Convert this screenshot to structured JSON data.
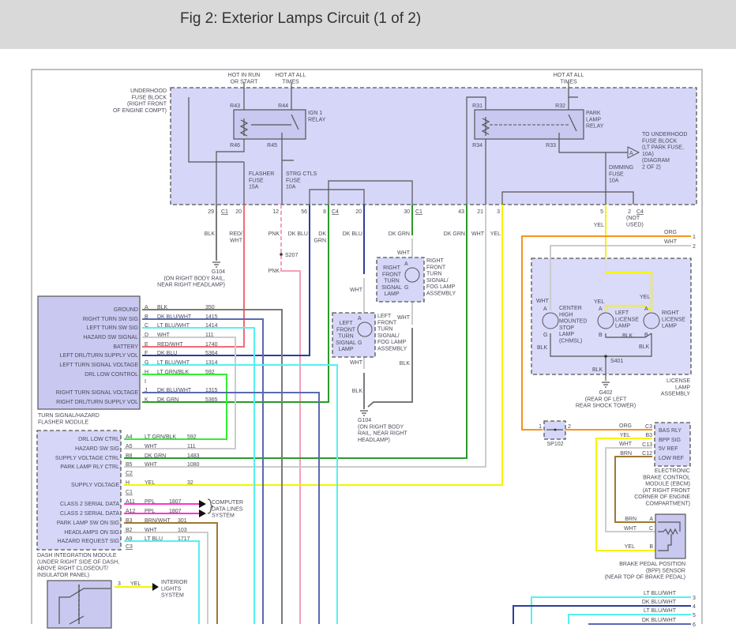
{
  "header": {
    "title": "Fig 2: Exterior Lamps Circuit (1 of 2)"
  },
  "colors": {
    "BLK": "#7a7a7a",
    "RED/WHT": "#f06a78",
    "PNK": "#f5a0b8",
    "DK BLU": "#2c3e9e",
    "DK GRN": "#2a9a2a",
    "LT BLU/WHT": "#55f0f0",
    "WHT": "#cccccc",
    "YEL": "#f4f400",
    "ORG": "#f7931e",
    "LT GRN/BLK": "#33ee33",
    "BRN": "#a07830",
    "PPL": "#ff33cc",
    "DK BLU/WHT": "#5a6ab0",
    "module_fill": "#d6d6f8"
  },
  "power": {
    "hot_run_start": "HOT IN RUN\nOR START",
    "hot_all_times_1": "HOT AT ALL\nTIMES",
    "hot_all_times_2": "HOT AT ALL\nTIMES"
  },
  "fuse_block": {
    "label": "UNDERHOOD\nFUSE BLOCK\n(RIGHT FRONT\nOF ENGINE COMPT)",
    "ign_relay": "IGN 1\nRELAY",
    "park_relay": "PARK\nLAMP\nRELAY",
    "terminals": {
      "r43": "R43",
      "r44": "R44",
      "r45": "R45",
      "r46": "R46",
      "r31": "R31",
      "r32": "R32",
      "r33": "R33",
      "r34": "R34"
    },
    "flasher_fuse": "FLASHER\nFUSE\n15A",
    "strg_fuse": "STRG CTLS\nFUSE\n10A",
    "dimming_fuse": "DIMMING\nFUSE\n10A",
    "offpage_ref": "A",
    "to_underhood": "TO UNDERHOOD\nFUSE BLOCK\n(LT PARK FUSE,\n10A)\n(DIAGRAM\n2 OF 2)",
    "pins": [
      "29",
      "20",
      "12",
      "56",
      "8",
      "20",
      "30",
      "43",
      "21",
      "3",
      "5",
      "2"
    ],
    "connectors": {
      "c1a": "C1",
      "c4a": "C4",
      "c1b": "C1",
      "c4b": "C4"
    },
    "not_used": "(NOT\nUSED)"
  },
  "wire_labels": {
    "blk": "BLK",
    "red_wht": "RED/\nWHT",
    "pnk1": "PNK",
    "pnk2": "PNK",
    "dk_blu1": "DK BLU",
    "dk_grn1": "DK\nGRN",
    "dk_blu2": "DK BLU",
    "dk_grn2": "DK GRN",
    "dk_grn3": "DK GRN",
    "wht1": "WHT",
    "yel1": "YEL",
    "yel2": "YEL",
    "wht_lf1": "WHT",
    "wht_lf2": "WHT",
    "blk_lf": "BLK",
    "wht_rf1": "WHT",
    "wht_rf2": "WHT",
    "blk_rf": "BLK",
    "org": "ORG",
    "wht_lic": "WHT",
    "wire_num_1": "1",
    "wire_num_2": "2"
  },
  "splices": {
    "s207": "S207",
    "s401": "S401"
  },
  "grounds": {
    "g104a": "G104\n(ON RIGHT BODY RAIL,\nNEAR RIGHT HEADLAMP)",
    "g104b": "G104\n(ON RIGHT BODY\nRAIL, NEAR RIGHT\nHEADLAMP)",
    "g402": "G402\n(REAR OF LEFT\nREAR SHOCK TOWER)"
  },
  "front_lamps": {
    "right_lamp": "RIGHT\nFRONT\nTURN\nSIGNAL\nLAMP",
    "right_assembly": "RIGHT\nFRONT\nTURN\nSIGNAL/\nFOG LAMP\nASSEMBLY",
    "left_lamp": "LEFT\nFRONT\nTURN\nSIGNAL\nLAMP",
    "left_assembly": "LEFT\nFRONT\nTURN\nSIGNAL/\nFOG LAMP\nASSEMBLY",
    "pin_a": "A",
    "pin_g": "G"
  },
  "license_assembly": {
    "label": "LICENSE\nLAMP\nASSEMBLY",
    "chmsl": "CENTER\nHIGH\nMOUNTED\nSTOP\nLAMP\n(CHMSL)",
    "left": "LEFT\nLICENSE\nLAMP",
    "right": "RIGHT\nLICENSE\nLAMP",
    "wht": "WHT",
    "yel_l": "YEL",
    "yel_r": "YEL",
    "blk_mid": "BLK",
    "blk_l": "BLK",
    "blk_r": "BLK",
    "blk_g": "BLK",
    "pin_a": "A",
    "pin_g": "G",
    "pin_b": "B"
  },
  "flasher_module": {
    "name": "TURN SIGNAL/HAZARD\nFLASHER MODULE",
    "pins": [
      {
        "pin": "A",
        "label": "GROUND",
        "color": "BLK",
        "circuit": "350"
      },
      {
        "pin": "B",
        "label": "RIGHT TURN SW SIG",
        "color": "DK BLU/WHT",
        "circuit": "1415"
      },
      {
        "pin": "C",
        "label": "LEFT TURN SW SIG",
        "color": "LT BLU/WHT",
        "circuit": "1414"
      },
      {
        "pin": "D",
        "label": "HAZARD SW SIGNAL",
        "color": "WHT",
        "circuit": "111"
      },
      {
        "pin": "E",
        "label": "BATTERY",
        "color": "RED/WHT",
        "circuit": "1740"
      },
      {
        "pin": "F",
        "label": "LEFT DRL/TURN SUPPLY VOL",
        "color": "DK BLU",
        "circuit": "5364"
      },
      {
        "pin": "G",
        "label": "LEFT TURN SIGNAL VOLTAGE",
        "color": "LT BLU/WHT",
        "circuit": "1314"
      },
      {
        "pin": "H",
        "label": "DRL LOW CONTROL",
        "color": "LT GRN/BLK",
        "circuit": "592"
      },
      {
        "pin": "I",
        "label": "",
        "color": "",
        "circuit": ""
      },
      {
        "pin": "J",
        "label": "RIGHT TURN SIGNAL VOLTAGE",
        "color": "DK BLU/WHT",
        "circuit": "1315"
      },
      {
        "pin": "K",
        "label": "RIGHT DRL/TURN SUPPLY VOL",
        "color": "DK GRN",
        "circuit": "5365"
      }
    ]
  },
  "dash_module": {
    "name": "DASH INTEGRATION MODULE\n(UNDER RIGHT SIDE OF DASH,\nABOVE RIGHT CLOSEOUT/\nINSULATOR PANEL)",
    "pins": [
      {
        "pin": "A4",
        "label": "DRL LOW CTRL",
        "color": "LT GRN/BLK",
        "circuit": "592"
      },
      {
        "pin": "A5",
        "label": "HAZARD SW SIG",
        "color": "WHT",
        "circuit": "111"
      },
      {
        "pin": "B8",
        "label": "SUPPLY VOLTAGE CTRL",
        "color": "DK GRN",
        "circuit": "1483"
      },
      {
        "pin": "B5",
        "label": "PARK LAMP RLY CTRL",
        "color": "WHT",
        "circuit": "1080"
      },
      {
        "pin": "H",
        "label": "SUPPLY VOLTAGE",
        "color": "YEL",
        "circuit": "32"
      },
      {
        "pin": "A11",
        "label": "CLASS 2 SERIAL DATA",
        "color": "PPL",
        "circuit": "1807"
      },
      {
        "pin": "A12",
        "label": "CLASS 2 SERIAL DATA",
        "color": "PPL",
        "circuit": "1807"
      },
      {
        "pin": "B3",
        "label": "PARK LAMP SW ON SIG",
        "color": "BRN/WHT",
        "circuit": "301"
      },
      {
        "pin": "B2",
        "label": "HEADLAMPS ON SIG",
        "color": "WHT",
        "circuit": "103"
      },
      {
        "pin": "A9",
        "label": "HAZARD REQUEST SIG",
        "color": "LT BLU",
        "circuit": "1717"
      }
    ],
    "connectors": {
      "c2": "C2",
      "c1": "C1",
      "c3": "C3"
    },
    "data_lines": "COMPUTER\nDATA LINES\nSYSTEM"
  },
  "interior": {
    "pin": "3",
    "color": "YEL",
    "label": "INTERIOR\nLIGHTS\nSYSTEM"
  },
  "sp102": {
    "name": "SP102",
    "pin1": "1",
    "pin2": "2"
  },
  "ebcm": {
    "name": "ELECTRONIC\nBRAKE CONTROL\nMODULE (EBCM)\n(AT RIGHT FRONT\nCORNER OF ENGINE\nCOMPARTMENT)",
    "pins": [
      {
        "pin": "C3",
        "label": "BAS RLY",
        "color": "ORG"
      },
      {
        "pin": "B3",
        "label": "BPP SIG",
        "color": "YEL"
      },
      {
        "pin": "C13",
        "label": "5V REF",
        "color": "WHT"
      },
      {
        "pin": "C12",
        "label": "LOW REF",
        "color": "BRN"
      }
    ]
  },
  "bpp_sensor": {
    "name": "BRAKE PEDAL POSITION\n(BPP) SENSOR\n(NEAR TOP OF BRAKE PEDAL)",
    "pins": [
      {
        "pin": "A",
        "color": "BRN"
      },
      {
        "pin": "C",
        "color": "WHT"
      },
      {
        "pin": "B",
        "color": "YEL"
      }
    ]
  },
  "bottom_wires": [
    {
      "num": "3",
      "color": "LT BLU/WHT"
    },
    {
      "num": "4",
      "color": "DK BLU/WHT"
    },
    {
      "num": "5",
      "color": "LT BLU/WHT"
    },
    {
      "num": "6",
      "color": "DK BLU/WHT"
    }
  ]
}
